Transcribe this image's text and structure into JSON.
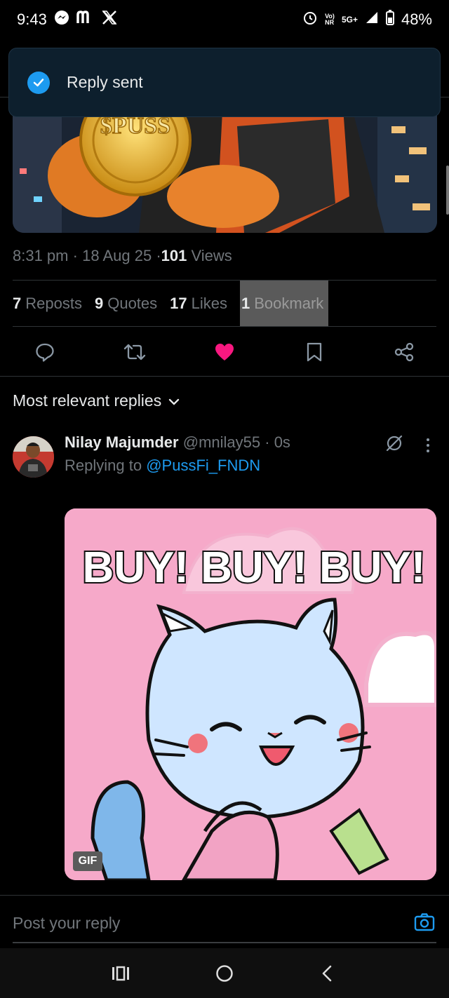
{
  "status_bar": {
    "time": "9:43",
    "left_icons": [
      "messenger-icon",
      "m-app-icon",
      "x-logo-icon"
    ],
    "net_top": "Vo)",
    "net_bottom": "NR",
    "net_type": "5G+",
    "battery": "48%"
  },
  "toast": {
    "text": "Reply sent"
  },
  "post": {
    "time": "8:31 pm",
    "date": "18 Aug 25",
    "views_count": "101",
    "views_label": "Views",
    "separator": "·",
    "coin_text": "$PUSS"
  },
  "stats": {
    "reposts_count": "7",
    "reposts_label": "Reposts",
    "quotes_count": "9",
    "quotes_label": "Quotes",
    "likes_count": "17",
    "likes_label": "Likes",
    "bookmarks_count": "1",
    "bookmarks_label": "Bookmark"
  },
  "actions": [
    "reply-icon",
    "repost-icon",
    "like-icon",
    "bookmark-icon",
    "share-icon"
  ],
  "colors": {
    "like": "#f91880",
    "link": "#1d9bf0",
    "toast_bg": "#0d1f2d"
  },
  "replies_filter": {
    "label": "Most relevant replies"
  },
  "reply": {
    "name": "Nilay Majumder",
    "handle": "@mnilay55",
    "time": "· 0s",
    "replying_prefix": "Replying to",
    "replying_to": "@PussFi_FNDN",
    "gif_text": "BUY! BUY! BUY!",
    "gif_badge": "GIF"
  },
  "composer": {
    "placeholder": "Post your reply"
  }
}
